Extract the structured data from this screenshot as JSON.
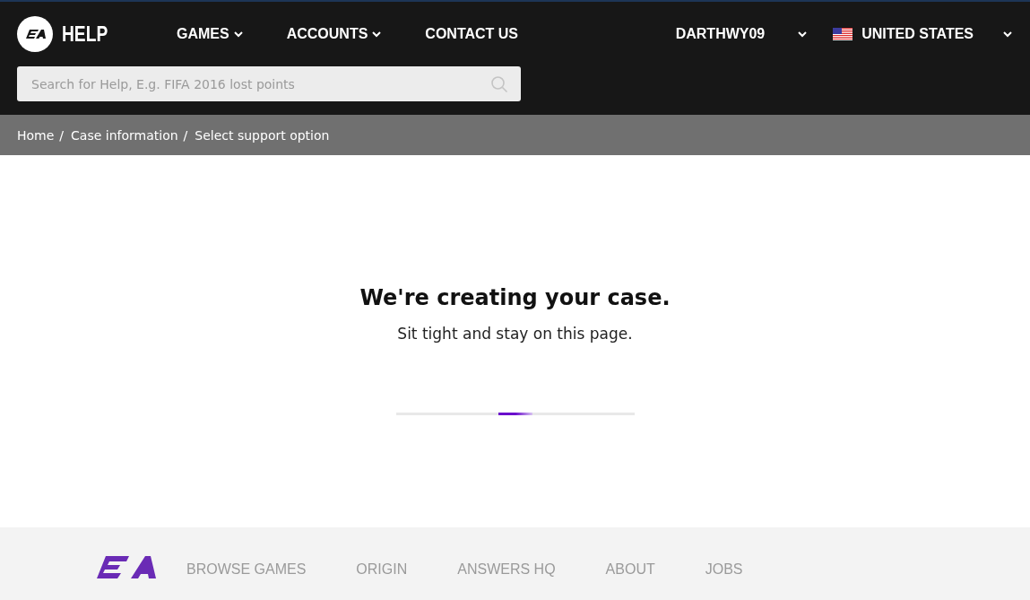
{
  "header": {
    "brand": "HELP",
    "nav": [
      {
        "label": "GAMES",
        "dropdown": true
      },
      {
        "label": "ACCOUNTS",
        "dropdown": true
      },
      {
        "label": "CONTACT US",
        "dropdown": false
      }
    ],
    "user": "DARTHWY09",
    "region": "UNITED STATES",
    "search": {
      "placeholder": "Search for Help, E.g. FIFA 2016 lost points"
    }
  },
  "breadcrumbs": {
    "separator": "/",
    "items": [
      "Home",
      "Case information",
      "Select support option"
    ]
  },
  "status": {
    "title": "We're creating your case.",
    "message": "Sit tight and stay on this page."
  },
  "footer": {
    "links": [
      "BROWSE GAMES",
      "ORIGIN",
      "ANSWERS HQ",
      "ABOUT",
      "JOBS"
    ]
  }
}
